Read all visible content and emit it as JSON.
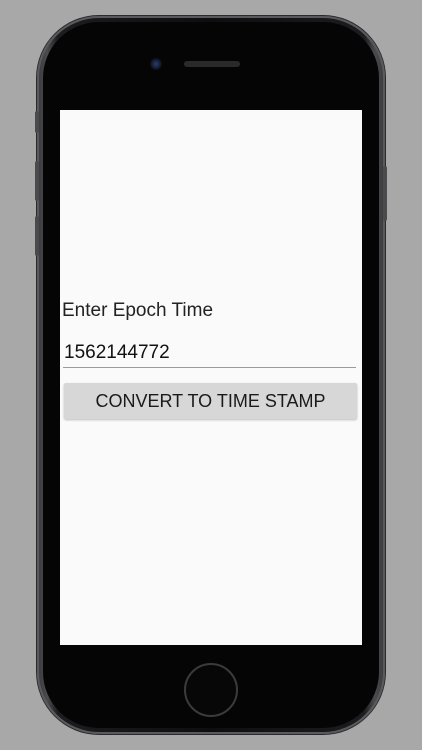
{
  "app": {
    "epoch_label": "Enter Epoch Time",
    "epoch_input": {
      "value": "1562144772",
      "placeholder": ""
    },
    "convert_button_label": "CONVERT TO TIME STAMP"
  },
  "device": {
    "frame_color": "#1c1c1e",
    "screen_background": "#fafafa",
    "page_background": "#a8a8a8"
  }
}
